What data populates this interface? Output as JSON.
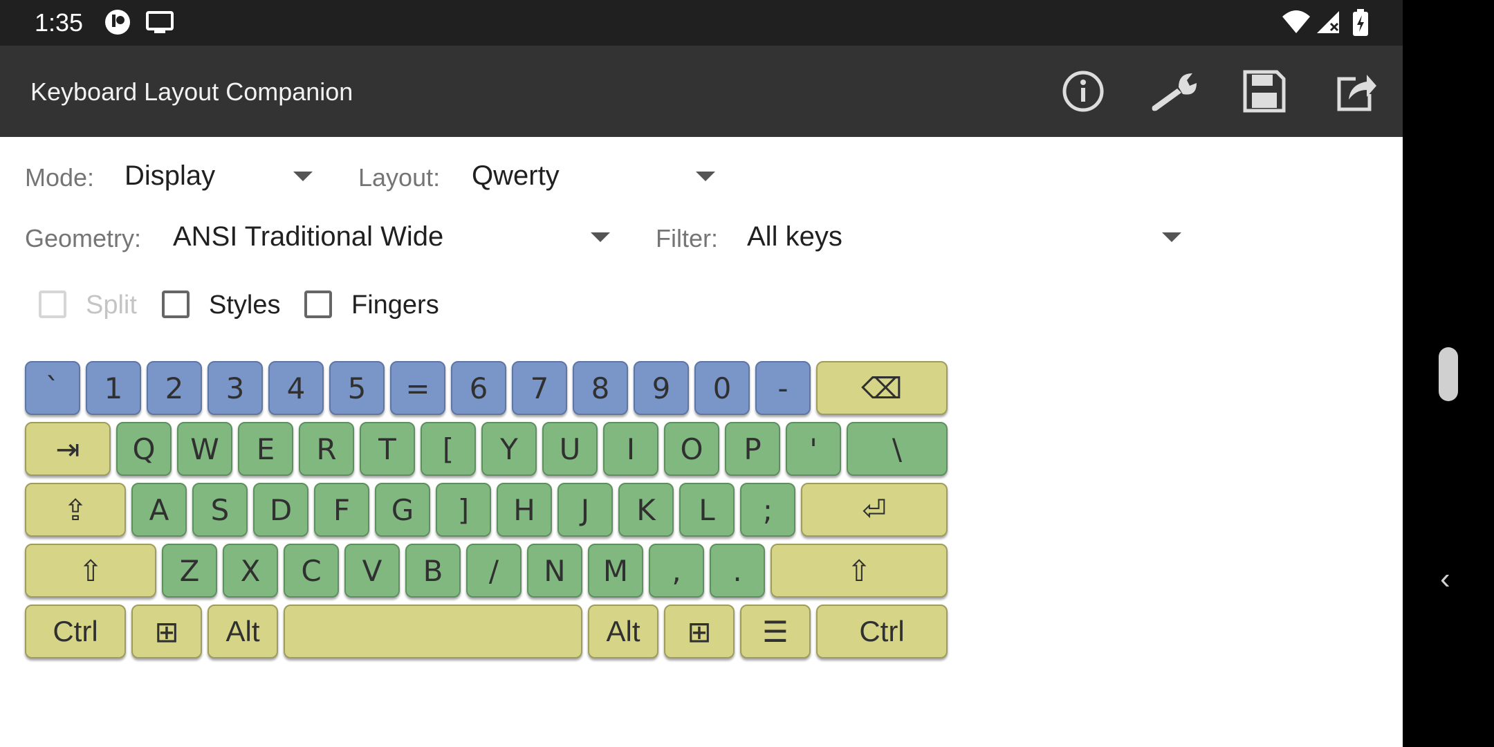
{
  "status_bar": {
    "time": "1:35",
    "icons": [
      "camera-privacy-icon",
      "cast-screen-icon",
      "wifi-icon",
      "signal-icon",
      "battery-charging-icon"
    ]
  },
  "app_bar": {
    "title": "Keyboard Layout Companion",
    "actions": [
      "info-icon",
      "wrench-settings-icon",
      "save-icon",
      "share-icon"
    ]
  },
  "controls": {
    "mode": {
      "label": "Mode:",
      "value": "Display"
    },
    "layout": {
      "label": "Layout:",
      "value": "Qwerty"
    },
    "geometry": {
      "label": "Geometry:",
      "value": "ANSI Traditional Wide"
    },
    "filter": {
      "label": "Filter:",
      "value": "All keys"
    },
    "split": {
      "label": "Split",
      "checked": false,
      "enabled": false
    },
    "styles": {
      "label": "Styles",
      "checked": false,
      "enabled": true
    },
    "fingers": {
      "label": "Fingers",
      "checked": false,
      "enabled": true
    }
  },
  "keyboard": {
    "colors": {
      "number_row": "#7a96c9",
      "letters": "#80b880",
      "modifiers": "#d6d486"
    },
    "rows": [
      [
        {
          "label": "`",
          "color": "blue"
        },
        {
          "label": "1",
          "color": "blue"
        },
        {
          "label": "2",
          "color": "blue"
        },
        {
          "label": "3",
          "color": "blue"
        },
        {
          "label": "4",
          "color": "blue"
        },
        {
          "label": "5",
          "color": "blue"
        },
        {
          "label": "=",
          "color": "blue"
        },
        {
          "label": "6",
          "color": "blue"
        },
        {
          "label": "7",
          "color": "blue"
        },
        {
          "label": "8",
          "color": "blue"
        },
        {
          "label": "9",
          "color": "blue"
        },
        {
          "label": "0",
          "color": "blue"
        },
        {
          "label": "-",
          "color": "blue"
        },
        {
          "label": "⌫",
          "color": "yellow",
          "name": "backspace"
        }
      ],
      [
        {
          "label": "⇥",
          "color": "yellow",
          "name": "tab"
        },
        {
          "label": "Q",
          "color": "green"
        },
        {
          "label": "W",
          "color": "green"
        },
        {
          "label": "E",
          "color": "green"
        },
        {
          "label": "R",
          "color": "green"
        },
        {
          "label": "T",
          "color": "green"
        },
        {
          "label": "[",
          "color": "green"
        },
        {
          "label": "Y",
          "color": "green"
        },
        {
          "label": "U",
          "color": "green"
        },
        {
          "label": "I",
          "color": "green"
        },
        {
          "label": "O",
          "color": "green"
        },
        {
          "label": "P",
          "color": "green"
        },
        {
          "label": "'",
          "color": "green"
        },
        {
          "label": "\\",
          "color": "green"
        }
      ],
      [
        {
          "label": "⇪",
          "color": "yellow",
          "name": "caps-lock"
        },
        {
          "label": "A",
          "color": "green"
        },
        {
          "label": "S",
          "color": "green"
        },
        {
          "label": "D",
          "color": "green"
        },
        {
          "label": "F",
          "color": "green"
        },
        {
          "label": "G",
          "color": "green"
        },
        {
          "label": "]",
          "color": "green"
        },
        {
          "label": "H",
          "color": "green"
        },
        {
          "label": "J",
          "color": "green"
        },
        {
          "label": "K",
          "color": "green"
        },
        {
          "label": "L",
          "color": "green"
        },
        {
          "label": ";",
          "color": "green"
        },
        {
          "label": "⏎",
          "color": "yellow",
          "name": "enter"
        }
      ],
      [
        {
          "label": "⇧",
          "color": "yellow",
          "name": "left-shift"
        },
        {
          "label": "Z",
          "color": "green"
        },
        {
          "label": "X",
          "color": "green"
        },
        {
          "label": "C",
          "color": "green"
        },
        {
          "label": "V",
          "color": "green"
        },
        {
          "label": "B",
          "color": "green"
        },
        {
          "label": "/",
          "color": "green"
        },
        {
          "label": "N",
          "color": "green"
        },
        {
          "label": "M",
          "color": "green"
        },
        {
          "label": ",",
          "color": "green"
        },
        {
          "label": ".",
          "color": "green"
        },
        {
          "label": "⇧",
          "color": "yellow",
          "name": "right-shift"
        }
      ],
      [
        {
          "label": "Ctrl",
          "color": "yellow",
          "name": "left-ctrl"
        },
        {
          "label": "⊞",
          "color": "yellow",
          "name": "left-win"
        },
        {
          "label": "Alt",
          "color": "yellow",
          "name": "left-alt"
        },
        {
          "label": "",
          "color": "yellow",
          "name": "space"
        },
        {
          "label": "Alt",
          "color": "yellow",
          "name": "right-alt"
        },
        {
          "label": "⊞",
          "color": "yellow",
          "name": "right-win"
        },
        {
          "label": "☰",
          "color": "yellow",
          "name": "menu"
        },
        {
          "label": "Ctrl",
          "color": "yellow",
          "name": "right-ctrl"
        }
      ]
    ]
  }
}
